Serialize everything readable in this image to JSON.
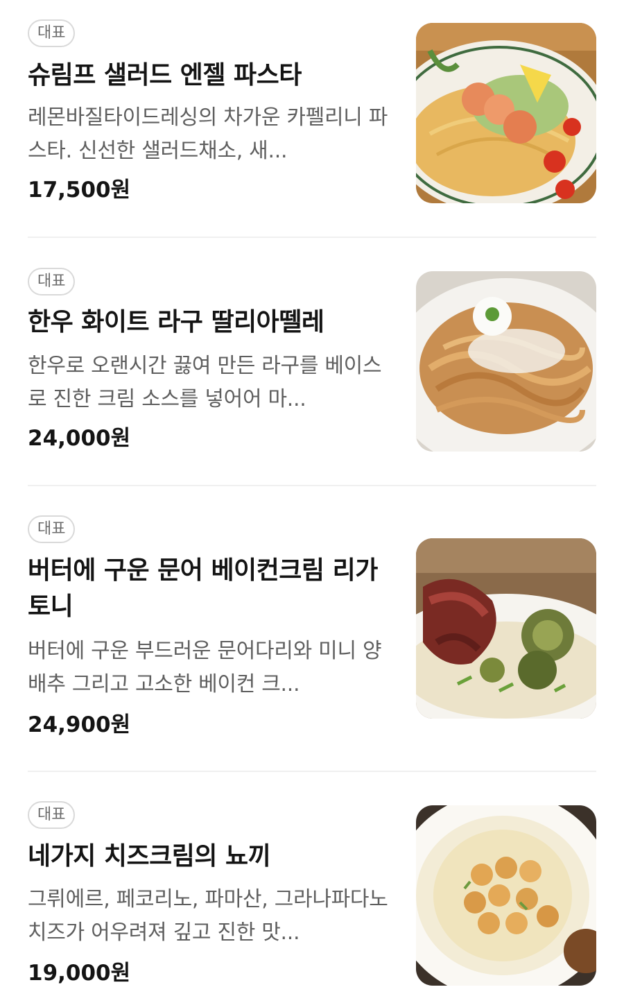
{
  "menu": {
    "items": [
      {
        "badge": "대표",
        "name": "슈림프 샐러드 엔젤 파스타",
        "description": "레몬바질타이드레싱의 차가운 카펠리니 파스타. 신선한 샐러드채소, 새...",
        "price": "17,500원",
        "image_icon": "shrimp-salad-pasta-photo"
      },
      {
        "badge": "대표",
        "name": "한우 화이트 라구 딸리아뗄레",
        "description": "한우로 오랜시간 끓여 만든 라구를 베이스로 진한 크림 소스를 넣어어 마...",
        "price": "24,000원",
        "image_icon": "ragu-tagliatelle-photo"
      },
      {
        "badge": "대표",
        "name": "버터에 구운 문어 베이컨크림 리가토니",
        "description": "버터에 구운 부드러운 문어다리와 미니 양배추 그리고 고소한 베이컨 크...",
        "price": "24,900원",
        "image_icon": "octopus-rigatoni-photo"
      },
      {
        "badge": "대표",
        "name": "네가지 치즈크림의 뇨끼",
        "description": "그뤼에르, 페코리노, 파마산, 그라나파다노 치즈가 어우려져 깊고 진한 맛...",
        "price": "19,000원",
        "image_icon": "cheese-gnocchi-photo"
      }
    ]
  },
  "colors": {
    "text_primary": "#141414",
    "text_secondary": "#5e5e5e",
    "badge_border": "#d9d9d9",
    "divider": "#f0f0f0"
  }
}
